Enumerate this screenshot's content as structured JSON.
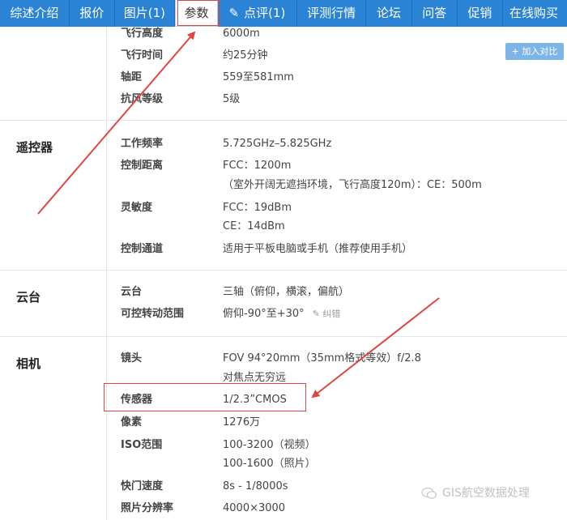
{
  "nav": {
    "items": [
      {
        "label": "综述介绍"
      },
      {
        "label": "报价"
      },
      {
        "label": "图片(1)"
      },
      {
        "label": "参数"
      },
      {
        "label": "点评(1)"
      },
      {
        "label": "评测行情"
      },
      {
        "label": "论坛"
      },
      {
        "label": "问答"
      },
      {
        "label": "促销"
      },
      {
        "label": "在线购买"
      }
    ]
  },
  "add_compare": "+ 加入对比",
  "sections": {
    "flight": {
      "rows": [
        {
          "key": "飞行高度",
          "value": "6000m"
        },
        {
          "key": "飞行时间",
          "value": "约25分钟"
        },
        {
          "key": "轴距",
          "value": "559至581mm"
        },
        {
          "key": "抗风等级",
          "value": "5级"
        }
      ]
    },
    "remote": {
      "title": "遥控器",
      "rows": [
        {
          "key": "工作频率",
          "value": "5.725GHz–5.825GHz"
        },
        {
          "key": "控制距离",
          "value": "FCC：1200m"
        },
        {
          "key": "",
          "value": "（室外开阔无遮挡环境，飞行高度120m）：CE：500m"
        },
        {
          "key": "灵敏度",
          "value": "FCC：19dBm"
        },
        {
          "key": "",
          "value": "CE：14dBm"
        },
        {
          "key": "控制通道",
          "value": "适用于平板电脑或手机（推荐使用手机）"
        }
      ]
    },
    "gimbal": {
      "title": "云台",
      "rows": [
        {
          "key": "云台",
          "value": "三轴（俯仰，横滚，偏航）"
        },
        {
          "key": "可控转动范围",
          "value": "俯仰-90°至+30°",
          "extra": "纠错"
        }
      ]
    },
    "camera": {
      "title": "相机",
      "rows": [
        {
          "key": "镜头",
          "value": "FOV 94°20mm（35mm格式等效）f/2.8"
        },
        {
          "key": "",
          "value": "对焦点无穷远"
        },
        {
          "key": "传感器",
          "value": "1/2.3”CMOS"
        },
        {
          "key": "像素",
          "value": "1276万"
        },
        {
          "key": "ISO范围",
          "value": "100-3200（视频）"
        },
        {
          "key": "",
          "value": "100-1600（照片）"
        },
        {
          "key": "快门速度",
          "value": "8s - 1/8000s"
        },
        {
          "key": "照片分辨率",
          "value": "4000×3000"
        }
      ]
    }
  },
  "watermark": "GIS航空数据处理",
  "colors": {
    "nav_bg": "#2b83d6",
    "highlight": "#e0453f"
  }
}
